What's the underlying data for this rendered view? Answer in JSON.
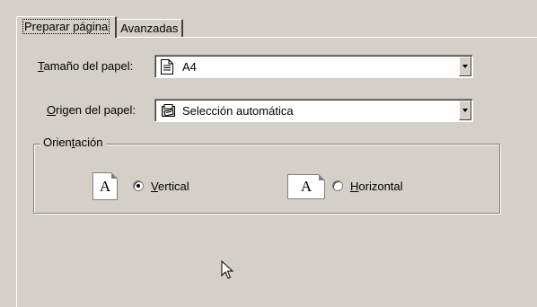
{
  "tabs": [
    {
      "label": "Preparar página",
      "active": true
    },
    {
      "label": "Avanzadas",
      "active": false
    }
  ],
  "paper_size": {
    "label_prefix": "",
    "hotkey": "T",
    "label_rest": "amaño del papel:",
    "value": "A4",
    "icon": "document-icon"
  },
  "paper_source": {
    "hotkey": "O",
    "label_rest": "rigen del papel:",
    "value": "Selección automática",
    "icon": "printer-tray-icon"
  },
  "orientation": {
    "legend_pre": "Orien",
    "legend_hotkey": "t",
    "legend_post": "ación",
    "vertical": {
      "hotkey": "V",
      "rest": "ertical",
      "selected": true
    },
    "horizontal": {
      "hotkey": "H",
      "rest": "orizontal",
      "selected": false
    },
    "page_glyph": "A"
  },
  "colors": {
    "face": "#d4d0c8",
    "shadow": "#808080",
    "highlight": "#ffffff"
  }
}
